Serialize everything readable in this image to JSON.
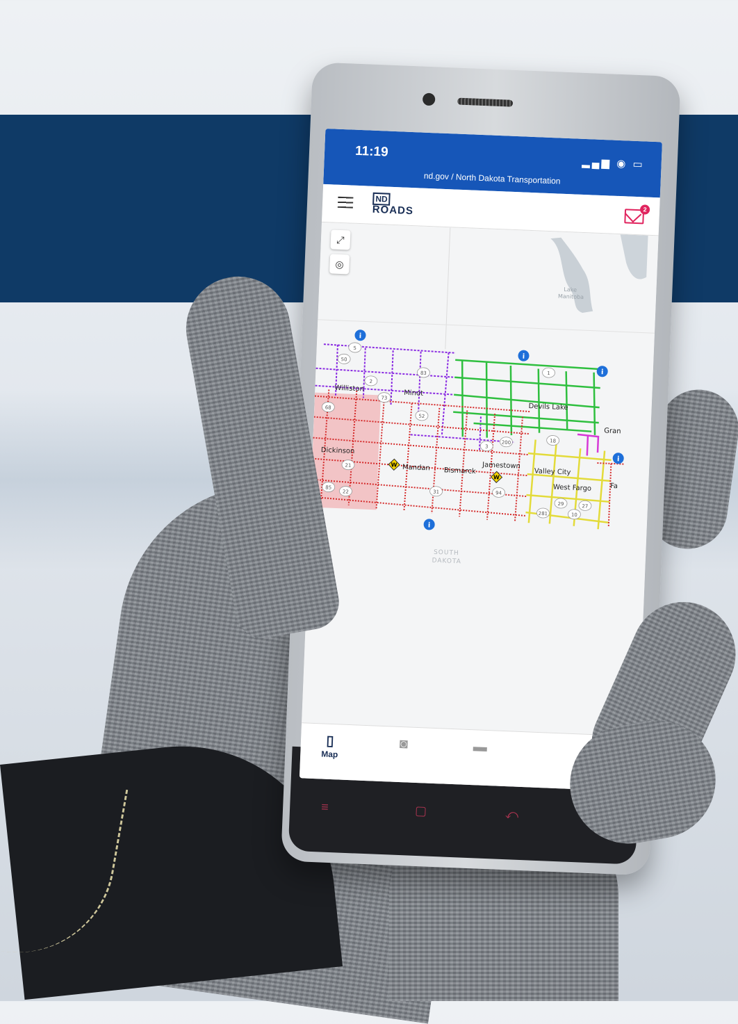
{
  "status_bar": {
    "time": "11:19",
    "icons": "▂▄▆ ◉ ▭"
  },
  "breadcrumb": "nd.gov / North Dakota Transportation",
  "header": {
    "logo_top": "ND",
    "logo_bottom": "ROADS",
    "mail_badge": "2"
  },
  "map": {
    "labels": {
      "williston": "Williston",
      "minot": "Minot",
      "devils_lake": "Devils Lake",
      "grand": "Gran",
      "dickinson": "Dickinson",
      "mandan": "Mandan",
      "bismarck": "Bismarck",
      "jamestown": "Jamestown",
      "valley_city": "Valley City",
      "west_fargo": "West Fargo",
      "fa": "Fa",
      "south_dakota_1": "SOUTH",
      "south_dakota_2": "DAKOTA",
      "lake_1": "Lake",
      "lake_2": "Manitoba"
    },
    "route_shields": [
      "50",
      "5",
      "2",
      "83",
      "1",
      "68",
      "73",
      "85",
      "22",
      "3",
      "200",
      "52",
      "94",
      "31",
      "21",
      "281",
      "10",
      "29",
      "27",
      "18"
    ],
    "region_colors": {
      "northwest": "#8a2be2",
      "northeast": "#2fbf3f",
      "southwest": "#d42a2a",
      "southeast": "#e3db3a",
      "east_edge": "#d63ad6"
    }
  },
  "tabs": [
    {
      "label": "Map",
      "icon": "map-icon"
    },
    {
      "label": "",
      "icon": "camera-icon"
    },
    {
      "label": "",
      "icon": "truck-icon"
    }
  ]
}
